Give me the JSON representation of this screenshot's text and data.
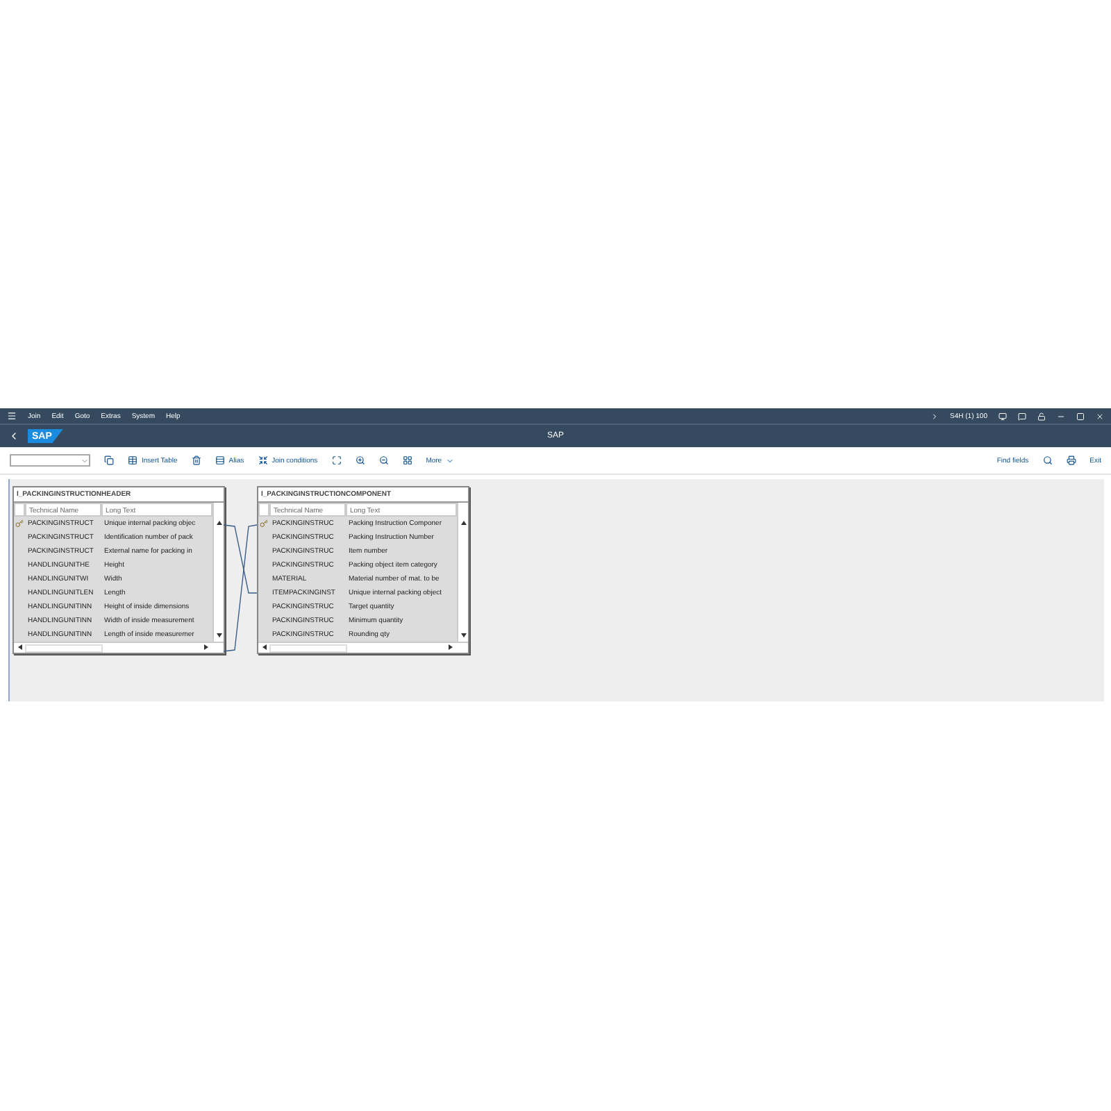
{
  "menu_bar": {
    "items": [
      "Join",
      "Edit",
      "Goto",
      "Extras",
      "System",
      "Help"
    ],
    "session": "S4H (1) 100"
  },
  "title_bar": {
    "logo": "SAP",
    "title": "SAP"
  },
  "toolbar": {
    "left": [
      {
        "kind": "dropdown"
      },
      {
        "kind": "icon"
      },
      {
        "kind": "button",
        "label": "Insert Table"
      },
      {
        "kind": "icon"
      },
      {
        "kind": "button",
        "label": "Alias"
      },
      {
        "kind": "button",
        "label": "Join conditions"
      },
      {
        "kind": "icon"
      },
      {
        "kind": "icon"
      },
      {
        "kind": "icon"
      },
      {
        "kind": "icon"
      },
      {
        "kind": "menu",
        "label": "More"
      }
    ],
    "right": [
      {
        "kind": "button",
        "label": "Find fields"
      },
      {
        "kind": "icon"
      },
      {
        "kind": "icon"
      },
      {
        "kind": "button",
        "label": "Exit"
      }
    ]
  },
  "tables": [
    {
      "name": "I_PACKINGINSTRUCTIONHEADER",
      "columns": [
        "Technical Name",
        "Long Text"
      ],
      "rows": [
        {
          "key": true,
          "technical": "PACKINGINSTRUCT",
          "text": "Unique internal packing objec"
        },
        {
          "key": false,
          "technical": "PACKINGINSTRUCT",
          "text": "Identification number of pack"
        },
        {
          "key": false,
          "technical": "PACKINGINSTRUCT",
          "text": "External name for packing in"
        },
        {
          "key": false,
          "technical": "HANDLINGUNITHE",
          "text": "Height"
        },
        {
          "key": false,
          "technical": "HANDLINGUNITWI",
          "text": "Width"
        },
        {
          "key": false,
          "technical": "HANDLINGUNITLEN",
          "text": "Length"
        },
        {
          "key": false,
          "technical": "HANDLINGUNITINN",
          "text": "Height of inside dimensions"
        },
        {
          "key": false,
          "technical": "HANDLINGUNITINN",
          "text": "Width of inside measurement"
        },
        {
          "key": false,
          "technical": "HANDLINGUNITINN",
          "text": "Length of inside measuremer"
        }
      ]
    },
    {
      "name": "I_PACKINGINSTRUCTIONCOMPONENT",
      "columns": [
        "Technical Name",
        "Long Text"
      ],
      "rows": [
        {
          "key": true,
          "technical": "PACKINGINSTRUC",
          "text": "Packing Instruction Componer"
        },
        {
          "key": false,
          "technical": "PACKINGINSTRUC",
          "text": "Packing Instruction Number"
        },
        {
          "key": false,
          "technical": "PACKINGINSTRUC",
          "text": "Item number"
        },
        {
          "key": false,
          "technical": "PACKINGINSTRUC",
          "text": "Packing object item category"
        },
        {
          "key": false,
          "technical": "MATERIAL",
          "text": "Material number of mat. to be"
        },
        {
          "key": false,
          "technical": "ITEMPACKINGINST",
          "text": "Unique internal packing object"
        },
        {
          "key": false,
          "technical": "PACKINGINSTRUC",
          "text": "Target quantity"
        },
        {
          "key": false,
          "technical": "PACKINGINSTRUC",
          "text": "Minimum quantity"
        },
        {
          "key": false,
          "technical": "PACKINGINSTRUC",
          "text": "Rounding qty"
        }
      ]
    }
  ]
}
